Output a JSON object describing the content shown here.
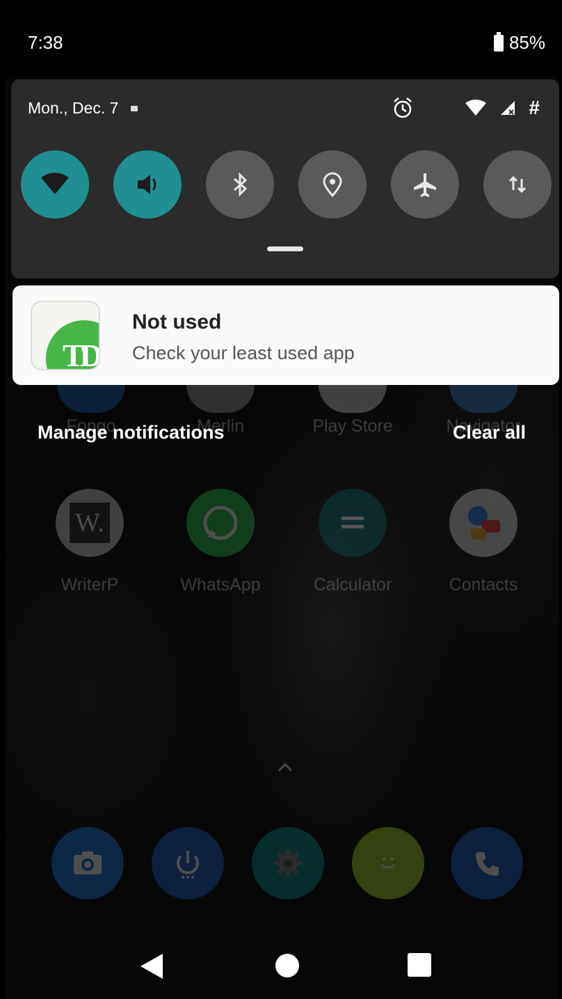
{
  "status_bar": {
    "time": "7:38",
    "battery": "85%"
  },
  "quick_settings": {
    "date": "Mon., Dec. 7",
    "tiles": [
      {
        "name": "wifi",
        "icon": "wifi-icon",
        "active": true
      },
      {
        "name": "sound",
        "icon": "volume-icon",
        "active": true
      },
      {
        "name": "bluetooth",
        "icon": "bluetooth-icon",
        "active": false
      },
      {
        "name": "location",
        "icon": "location-icon",
        "active": false
      },
      {
        "name": "airplane mode",
        "icon": "airplane-icon",
        "active": false
      },
      {
        "name": "mobile data",
        "icon": "data-arrows-icon",
        "active": false
      }
    ]
  },
  "notification": {
    "app_icon_letters": "TD",
    "title": "Not used",
    "text": "Check your least used app"
  },
  "shade_actions": {
    "manage": "Manage notifications",
    "clear": "Clear all"
  },
  "home_apps": {
    "row1_labels": [
      "Fongo",
      "Merlin",
      "Play Store",
      "Navigator"
    ],
    "row2": [
      {
        "label": "WriterP",
        "icon": "writer-icon"
      },
      {
        "label": "WhatsApp",
        "icon": "whatsapp-icon"
      },
      {
        "label": "Calculator",
        "icon": "calculator-icon"
      },
      {
        "label": "Contacts",
        "icon": "contacts-icon"
      }
    ],
    "dock": [
      "camera-icon",
      "power-icon",
      "settings-icon",
      "messaging-icon",
      "phone-icon"
    ]
  },
  "colors": {
    "tile_active": "#1f8f93",
    "tile_inactive": "#5a5a5a",
    "panel": "#2b2b2b",
    "td_green": "#46b649"
  }
}
